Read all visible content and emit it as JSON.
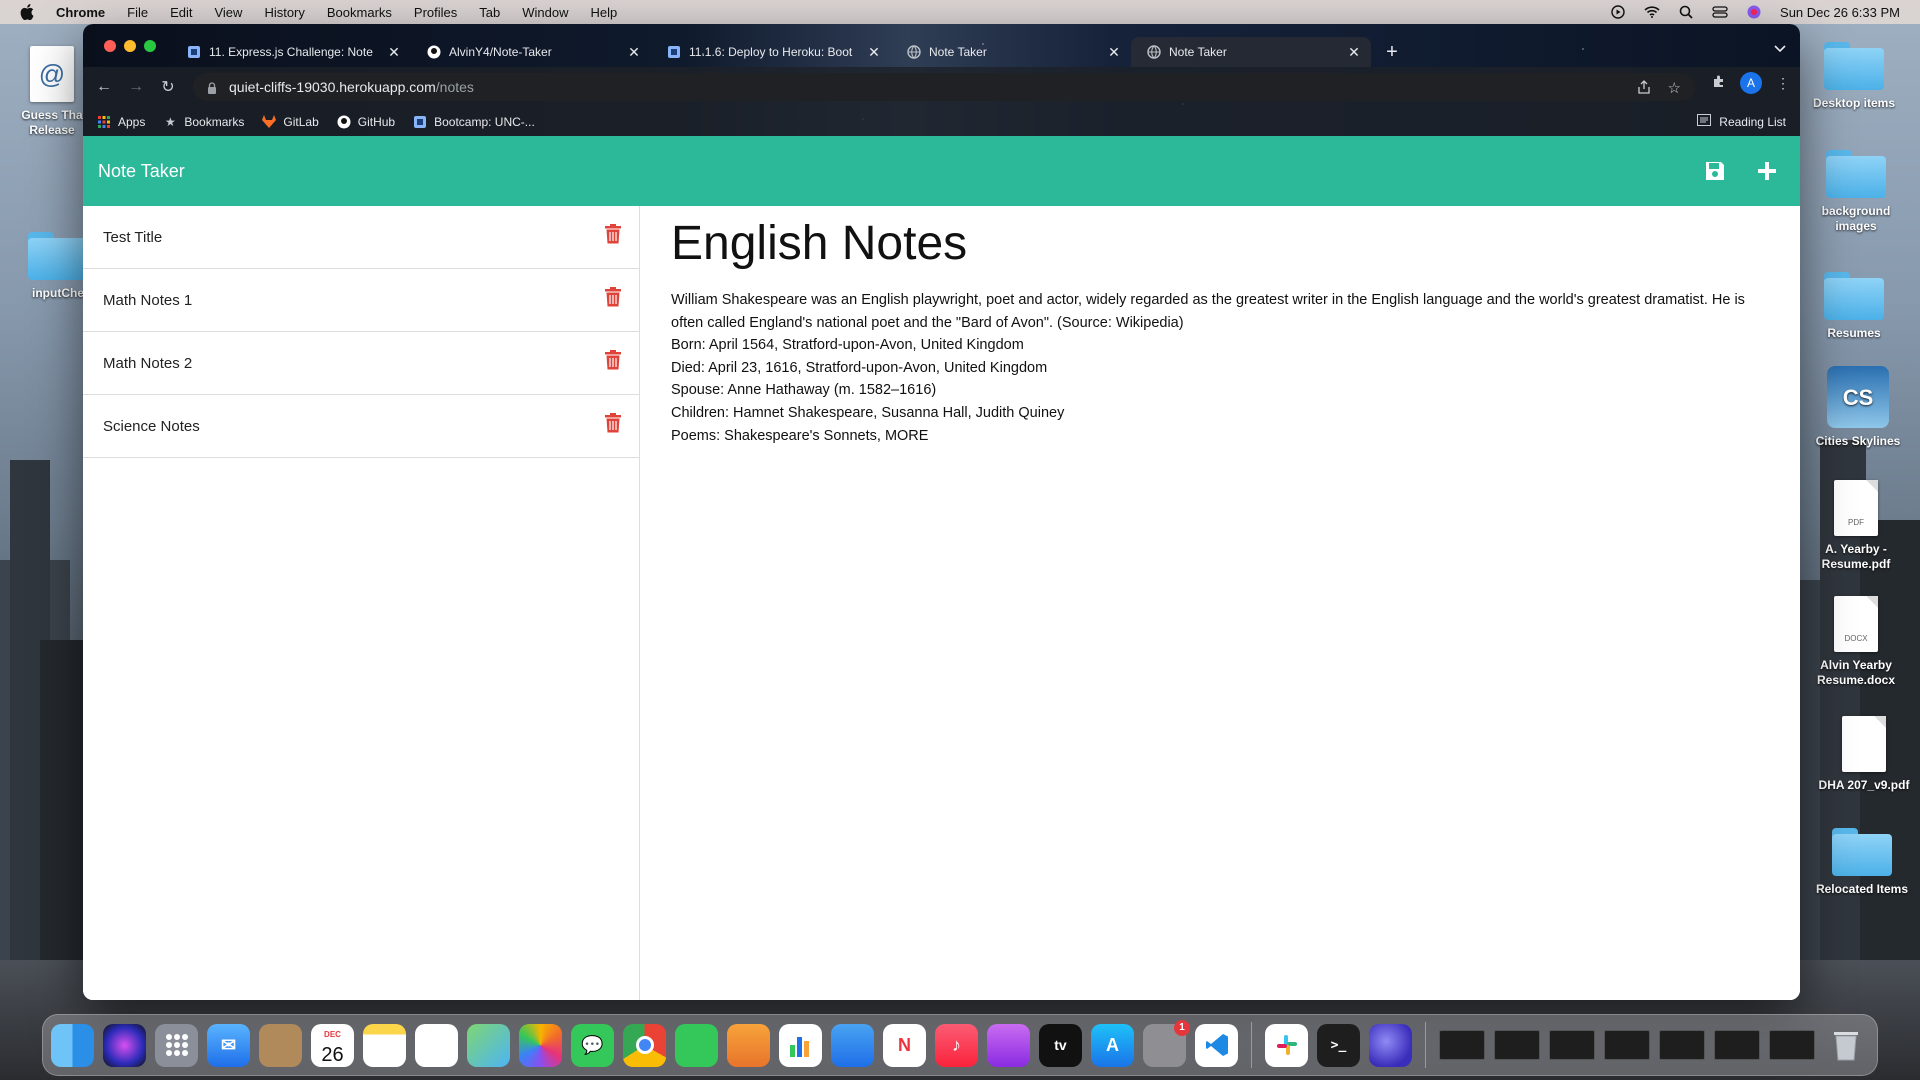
{
  "menubar": {
    "app": "Chrome",
    "items": [
      "File",
      "Edit",
      "View",
      "History",
      "Bookmarks",
      "Profiles",
      "Tab",
      "Window",
      "Help"
    ],
    "clock": "Sun Dec 26  6:33 PM"
  },
  "desktop": {
    "left_icons": [
      {
        "label": "Guess Tha\nRelease"
      },
      {
        "label": "inputChe"
      }
    ],
    "right_icons": [
      {
        "label": "Desktop items"
      },
      {
        "label": "background images"
      },
      {
        "label": "Resumes"
      },
      {
        "label": "Cities Skylines",
        "glyph": "CS"
      },
      {
        "label": "A. Yearby - Resume.pdf",
        "ext": "PDF"
      },
      {
        "label": "Alvin Yearby Resume.docx",
        "ext": "DOCX"
      },
      {
        "label": "DHA 207_v9.pdf"
      },
      {
        "label": "Relocated Items"
      }
    ]
  },
  "browser": {
    "tabs": [
      {
        "title": "11. Express.js Challenge: Note",
        "active": false
      },
      {
        "title": "AlvinY4/Note-Taker",
        "active": false
      },
      {
        "title": "11.1.6: Deploy to Heroku: Boot",
        "active": false
      },
      {
        "title": "Note Taker",
        "active": false
      },
      {
        "title": "Note Taker",
        "active": true
      }
    ],
    "url_host": "quiet-cliffs-19030.herokuapp.com",
    "url_path": "/notes",
    "avatar_letter": "A",
    "bookmarks": [
      "Apps",
      "Bookmarks",
      "GitLab",
      "GitHub",
      "Bootcamp: UNC-..."
    ],
    "reading_list": "Reading List"
  },
  "app": {
    "brand": "Note Taker",
    "notes": [
      {
        "title": "Test Title"
      },
      {
        "title": "Math Notes 1"
      },
      {
        "title": "Math Notes 2"
      },
      {
        "title": "Science Notes"
      }
    ],
    "active_note": {
      "title": "English Notes",
      "body": "William Shakespeare was an English playwright, poet and actor, widely regarded as the greatest writer in the English language and the world's greatest dramatist. He is often called England's national poet and the \"Bard of Avon\". (Source: Wikipedia)\nBorn: April 1564, Stratford-upon-Avon, United Kingdom\nDied: April 23, 1616, Stratford-upon-Avon, United Kingdom\nSpouse: Anne Hathaway (m. 1582–1616)\nChildren: Hamnet Shakespeare, Susanna Hall, Judith Quiney\nPoems: Shakespeare's Sonnets, MORE"
    },
    "colors": {
      "navbar": "#2bb99a",
      "delete": "#e0433a"
    }
  },
  "dock": {
    "calendar_month": "DEC",
    "calendar_day": "26",
    "settings_badge": "1",
    "appletv_label": "tv"
  }
}
